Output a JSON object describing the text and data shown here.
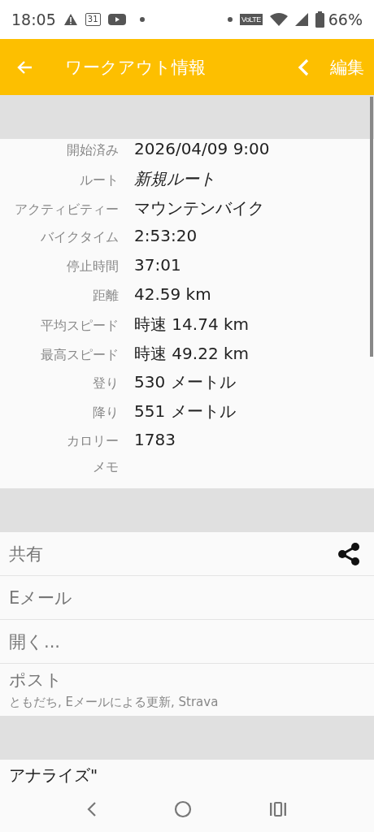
{
  "status_bar": {
    "time": "18:05",
    "calendar_day": "31",
    "network_label": "VoLTE",
    "battery": "66%"
  },
  "app_bar": {
    "title": "ワークアウト情報",
    "edit": "編集"
  },
  "details": [
    {
      "label": "開始済み",
      "value": "2026/04/09 9:00",
      "italic": false
    },
    {
      "label": "ルート",
      "value": "新規ルート",
      "italic": true
    },
    {
      "label": "アクティビティー",
      "value": "マウンテンバイク",
      "italic": false
    },
    {
      "label": "バイクタイム",
      "value": "2:53:20",
      "italic": false
    },
    {
      "label": "停止時間",
      "value": "37:01",
      "italic": false
    },
    {
      "label": "距離",
      "value": "42.59 km",
      "italic": false
    },
    {
      "label": "平均スピード",
      "value": "時速 14.74 km",
      "italic": false
    },
    {
      "label": "最高スピード",
      "value": "時速 49.22 km",
      "italic": false
    },
    {
      "label": "登り",
      "value": "530 メートル",
      "italic": false
    },
    {
      "label": "降り",
      "value": "551 メートル",
      "italic": false
    },
    {
      "label": "カロリー",
      "value": "1783",
      "italic": false
    },
    {
      "label": "メモ"
    }
  ],
  "actions": [
    {
      "kind": "share",
      "label": "共有"
    },
    {
      "kind": "plain",
      "label": "Eメール"
    },
    {
      "kind": "plain",
      "label": "開く..."
    },
    {
      "kind": "subtitle",
      "label": "ポスト",
      "subtitle": "ともだち, Eメールによる更新, Strava"
    }
  ],
  "analyze": {
    "title": "アナライズ\""
  }
}
